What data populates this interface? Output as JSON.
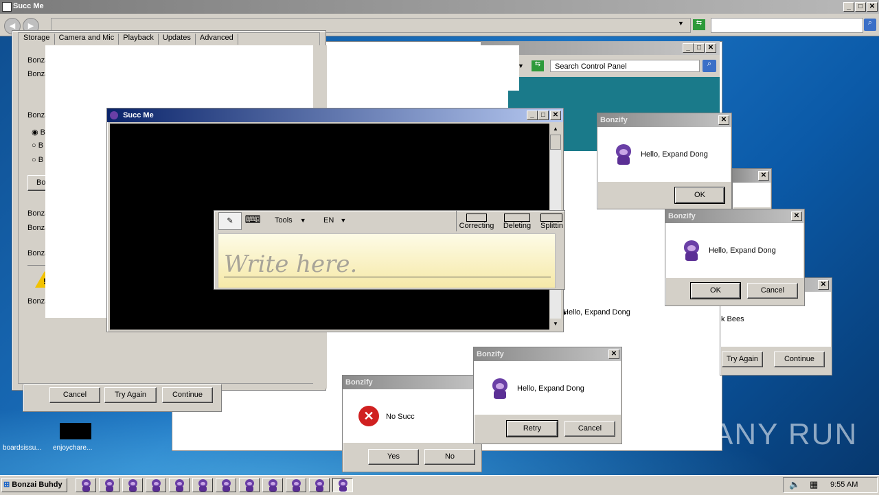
{
  "browser": {
    "title": "Succ Me",
    "search_value": ""
  },
  "desktop_icons": [
    {
      "label": "boardsissu..."
    },
    {
      "label": "enjoycharе..."
    }
  ],
  "settings_window": {
    "tabs": [
      "Storage",
      "Camera and Mic",
      "Playback",
      "Updates",
      "Advanced"
    ],
    "labels": [
      "Bonza",
      "Bonza",
      "Bonza",
      "Bonza",
      "Bonza",
      "Bonza"
    ],
    "radios": [
      "B",
      "B",
      "B"
    ],
    "button": "Bon",
    "footer_text": "Bonzai Buhdy",
    "buttons": {
      "cancel": "Cancel",
      "try_again": "Try Again",
      "continue": "Continue"
    }
  },
  "control_panel": {
    "search_placeholder": "Search Control Panel"
  },
  "succ_window": {
    "title": "Succ Me"
  },
  "tip": {
    "tools": "Tools",
    "lang": "EN",
    "correcting": "Correcting",
    "deleting": "Deleting",
    "splitting": "Splittin",
    "write_here": "Write here."
  },
  "dialogs": {
    "d1": {
      "title": "Bonzify",
      "message": "Hello, Expand Dong",
      "ok": "OK"
    },
    "d2": {
      "title": "Bonzify",
      "message": "Hello, Expand Dong",
      "ok": "OK",
      "cancel": "Cancel"
    },
    "d3": {
      "title": "Bonzify",
      "message": "Hello, Expand Dong",
      "retry": "Retry",
      "cancel": "Cancel"
    },
    "d4": {
      "title": "Bonzify",
      "message": "No Succ",
      "yes": "Yes",
      "no": "No"
    },
    "d5": {
      "message": "k Bees",
      "try_again": "Try Again",
      "continue": "Continue"
    },
    "bg_message": "Hello, Expand Dong"
  },
  "taskbar": {
    "start_label": "Bonzai Buhdy",
    "clock": "9:55 AM",
    "task_count": 12
  },
  "watermark": "ANY RUN"
}
